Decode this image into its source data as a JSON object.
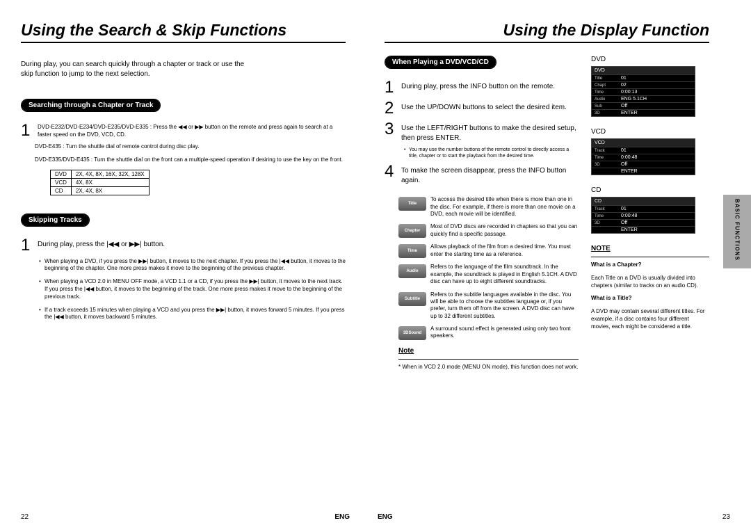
{
  "left": {
    "title": "Using the Search & Skip Functions",
    "intro": "During play, you can search quickly through a chapter or track or use the skip function to jump to the next selection.",
    "section1": {
      "heading": "Searching through a Chapter or Track",
      "step1_a": "DVD-E232/DVD-E234/DVD-E235/DVD-E335 : Press the  ◀◀ or ▶▶  button on the remote and press again to search at a faster speed on the DVD, VCD, CD.",
      "step1_b": "DVD-E435 : Turn the shuttle dial of remote control during disc play.",
      "step1_c": "DVD-E335/DVD-E435 : Turn the shuttle dial on the front can a multiple-speed operation if desiring to use the key on the front.",
      "table": [
        [
          "DVD",
          "2X, 4X, 8X, 16X, 32X, 128X"
        ],
        [
          "VCD",
          "4X, 8X"
        ],
        [
          "CD",
          "2X, 4X, 8X"
        ]
      ]
    },
    "section2": {
      "heading": "Skipping Tracks",
      "step1": "During play, press the  |◀◀  or  ▶▶|  button.",
      "bullets": [
        "When playing a DVD, if you press the  ▶▶|  button, it moves to the next chapter. If you press the  |◀◀  button, it moves to the beginning of the chapter. One more press makes it move to the beginning of the previous chapter.",
        "When playing a VCD 2.0 in MENU OFF mode, a VCD 1.1 or a CD, if you press the  ▶▶|  button, it moves to the next track. If you press the  |◀◀  button, it moves to the beginning of the track. One more press makes it move to the beginning of the previous track.",
        "If a track exceeds 15 minutes when playing a VCD and you press the  ▶▶| button, it moves forward 5 minutes. If you press the  |◀◀  button, it moves backward 5 minutes."
      ]
    },
    "pageNum": "22",
    "eng": "ENG"
  },
  "right": {
    "title": "Using the Display Function",
    "section1": {
      "heading": "When Playing a DVD/VCD/CD",
      "steps": [
        "During play, press the INFO button on the remote.",
        "Use the UP/DOWN buttons to select the desired item.",
        "Use the LEFT/RIGHT buttons to make the desired setup, then press ENTER.",
        "To make the screen disappear, press the INFO button again."
      ],
      "subnote": "You may use the number buttons of the remote control to directly access a title, chapter or to start the playback from the desired time.",
      "icons": [
        {
          "label": "Title",
          "text": "To access the desired title when there is more than one in the disc. For example, if there is more than one movie on a DVD, each movie will be identified."
        },
        {
          "label": "Chapter",
          "text": "Most of DVD discs are recorded in chapters so that you can quickly find a specific passage."
        },
        {
          "label": "Time",
          "text": "Allows playback of the film from a desired time. You must enter the starting time as a reference."
        },
        {
          "label": "Audio",
          "text": "Refers to the language of the film soundtrack. In the example, the soundtrack is played in English 5.1CH. A DVD disc can have up to eight different soundtracks."
        },
        {
          "label": "Subtitle",
          "text": "Refers to the subtitle languages available in the disc. You will be able to choose the subtitles language or, if you prefer, turn them off from the screen. A DVD disc can have up to 32 different subtitles."
        },
        {
          "label": "3DSound",
          "text": "A surround sound effect is generated using only two front speakers."
        }
      ],
      "noteTitle": "Note",
      "noteBody": "* When in VCD 2.0 mode (MENU ON mode), this function does not work."
    },
    "thumbs": {
      "dvd": {
        "label": "DVD",
        "rows": [
          [
            "DVD",
            ""
          ],
          [
            "Title",
            "01"
          ],
          [
            "Chapt",
            "02"
          ],
          [
            "Time",
            "0:00:13"
          ],
          [
            "Audio",
            "ENG 5.1CH"
          ],
          [
            "Sub",
            "Off"
          ],
          [
            "3D",
            "ENTER"
          ]
        ]
      },
      "vcd": {
        "label": "VCD",
        "rows": [
          [
            "VCD",
            ""
          ],
          [
            "Track",
            "01"
          ],
          [
            "Time",
            "0:00:48"
          ],
          [
            "3D",
            "Off"
          ],
          [
            "",
            "ENTER"
          ]
        ]
      },
      "cd": {
        "label": "CD",
        "rows": [
          [
            "CD",
            ""
          ],
          [
            "Track",
            "01"
          ],
          [
            "Time",
            "0:00:48"
          ],
          [
            "3D",
            "Off"
          ],
          [
            "",
            "ENTER"
          ]
        ]
      }
    },
    "rightNote": {
      "title": "NOTE",
      "q1": "What is a Chapter?",
      "a1": "Each Title on a DVD is usually divided into chapters (similar to tracks on an audio CD).",
      "q2": "What is a Title?",
      "a2": "A DVD may contain several different titles. For example, if a disc contains four different movies, each might be considered a title."
    },
    "sideTab": "BASIC FUNCTIONS",
    "pageNum": "23",
    "eng": "ENG"
  }
}
